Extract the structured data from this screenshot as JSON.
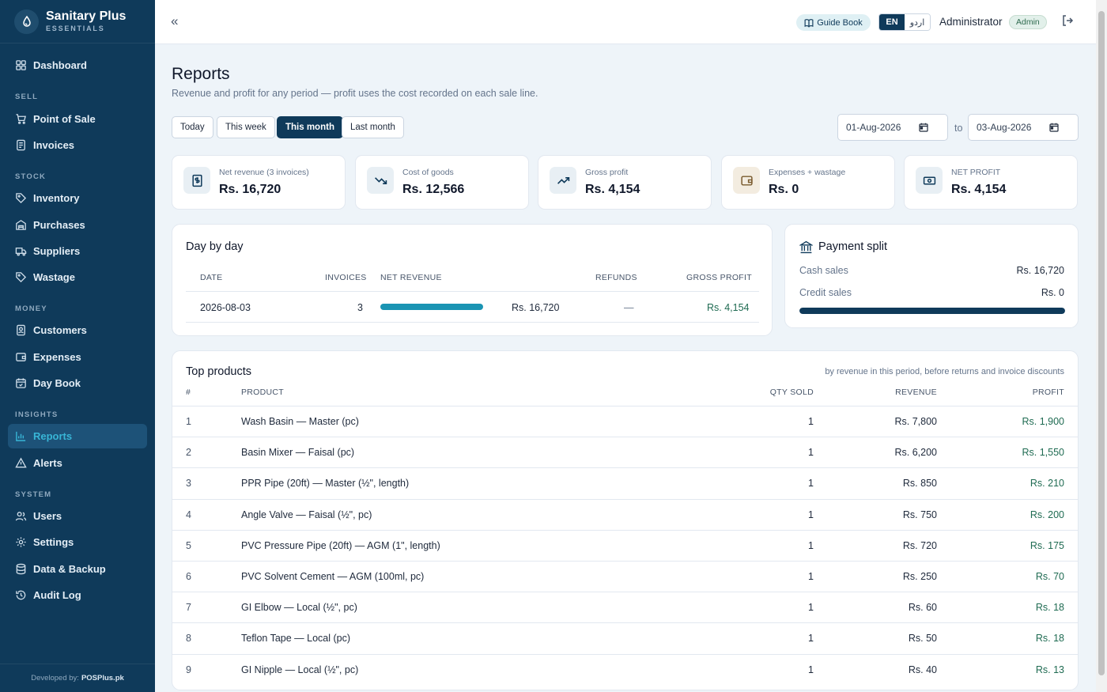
{
  "brand": {
    "name": "Sanitary Plus",
    "sub": "ESSENTIALS"
  },
  "nav": {
    "dashboard": "Dashboard",
    "sec_sell": "SELL",
    "pos": "Point of Sale",
    "invoices": "Invoices",
    "sec_stock": "STOCK",
    "inventory": "Inventory",
    "purchases": "Purchases",
    "suppliers": "Suppliers",
    "wastage": "Wastage",
    "sec_money": "MONEY",
    "customers": "Customers",
    "expenses": "Expenses",
    "daybook": "Day Book",
    "sec_insights": "INSIGHTS",
    "reports": "Reports",
    "alerts": "Alerts",
    "sec_system": "SYSTEM",
    "users": "Users",
    "settings": "Settings",
    "backup": "Data & Backup",
    "audit": "Audit Log"
  },
  "footer": {
    "prefix": "Developed by:",
    "company": "POSPlus.pk"
  },
  "topbar": {
    "collapse": "«",
    "guide": "Guide Book",
    "lang_en": "EN",
    "lang_ur": "اردو",
    "user": "Administrator",
    "role": "Admin"
  },
  "page": {
    "title": "Reports",
    "subtitle": "Revenue and profit for any period — profit uses the cost recorded on each sale line."
  },
  "periods": {
    "today": "Today",
    "week": "This week",
    "month": "This month",
    "last": "Last month",
    "active": "This month"
  },
  "dates": {
    "from": "01-Aug-2026",
    "to_label": "to",
    "to": "03-Aug-2026"
  },
  "stats": [
    {
      "label": "Net revenue (3 invoices)",
      "value": "Rs. 16,720",
      "icon": "receipt-icon"
    },
    {
      "label": "Cost of goods",
      "value": "Rs. 12,566",
      "icon": "trending-down-icon"
    },
    {
      "label": "Gross profit",
      "value": "Rs. 4,154",
      "icon": "trending-up-icon"
    },
    {
      "label": "Expenses + wastage",
      "value": "Rs. 0",
      "icon": "wallet-icon"
    },
    {
      "label": "NET PROFIT",
      "value": "Rs. 4,154",
      "icon": "cash-icon"
    }
  ],
  "daybyday": {
    "title": "Day by day",
    "headers": {
      "date": "DATE",
      "invoices": "INVOICES",
      "net": "NET REVENUE",
      "refunds": "REFUNDS",
      "gross": "GROSS PROFIT"
    },
    "rows": [
      {
        "date": "2026-08-03",
        "invoices": "3",
        "net": "Rs. 16,720",
        "net_fraction": 1.0,
        "refunds": "—",
        "gross": "Rs. 4,154"
      }
    ]
  },
  "payment": {
    "title": "Payment split",
    "cash_label": "Cash sales",
    "cash_value": "Rs. 16,720",
    "credit_label": "Credit sales",
    "credit_value": "Rs. 0",
    "cash_fraction": 1.0
  },
  "top": {
    "title": "Top products",
    "note": "by revenue in this period, before returns and invoice discounts",
    "headers": {
      "num": "#",
      "product": "PRODUCT",
      "qty": "QTY SOLD",
      "revenue": "REVENUE",
      "profit": "PROFIT"
    },
    "rows": [
      {
        "num": "1",
        "product": "Wash Basin — Master (pc)",
        "qty": "1",
        "revenue": "Rs. 7,800",
        "profit": "Rs. 1,900"
      },
      {
        "num": "2",
        "product": "Basin Mixer — Faisal (pc)",
        "qty": "1",
        "revenue": "Rs. 6,200",
        "profit": "Rs. 1,550"
      },
      {
        "num": "3",
        "product": "PPR Pipe (20ft) — Master (½\", length)",
        "qty": "1",
        "revenue": "Rs. 850",
        "profit": "Rs. 210"
      },
      {
        "num": "4",
        "product": "Angle Valve — Faisal (½\", pc)",
        "qty": "1",
        "revenue": "Rs. 750",
        "profit": "Rs. 200"
      },
      {
        "num": "5",
        "product": "PVC Pressure Pipe (20ft) — AGM (1\", length)",
        "qty": "1",
        "revenue": "Rs. 720",
        "profit": "Rs. 175"
      },
      {
        "num": "6",
        "product": "PVC Solvent Cement — AGM (100ml, pc)",
        "qty": "1",
        "revenue": "Rs. 250",
        "profit": "Rs. 70"
      },
      {
        "num": "7",
        "product": "GI Elbow — Local (½\", pc)",
        "qty": "1",
        "revenue": "Rs. 60",
        "profit": "Rs. 18"
      },
      {
        "num": "8",
        "product": "Teflon Tape — Local (pc)",
        "qty": "1",
        "revenue": "Rs. 50",
        "profit": "Rs. 18"
      },
      {
        "num": "9",
        "product": "GI Nipple — Local (½\", pc)",
        "qty": "1",
        "revenue": "Rs. 40",
        "profit": "Rs. 13"
      }
    ]
  },
  "colors": {
    "sidebar": "#0f3a5a",
    "accent": "#1a94b3",
    "profit": "#1f6b52",
    "active_nav": "#38b5d6"
  }
}
